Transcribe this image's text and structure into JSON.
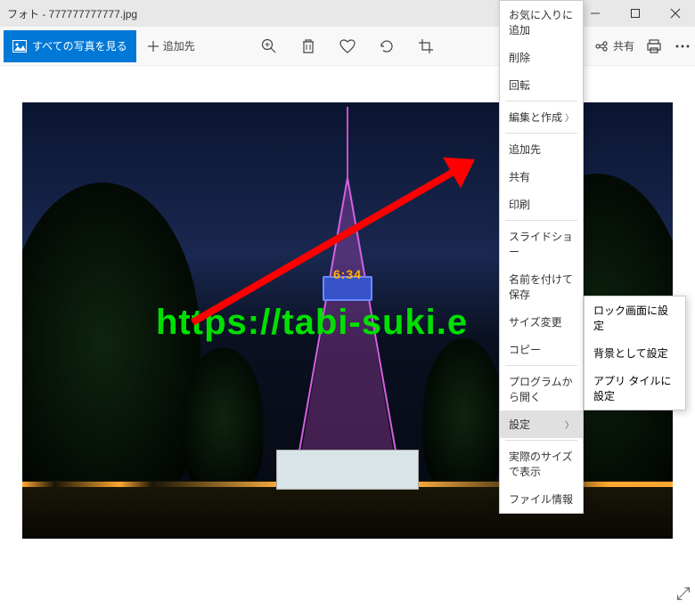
{
  "titlebar": {
    "title": "フォト - 777777777777.jpg"
  },
  "toolbar": {
    "view_all": "すべての写真を見る",
    "add_to": "追加先",
    "share": "共有"
  },
  "image": {
    "tower_sign": "6:34",
    "watermark": "https://tabi-suki.e"
  },
  "context_menu": {
    "items": [
      {
        "label": "お気に入りに追加",
        "arrow": false,
        "hl": false
      },
      {
        "label": "削除",
        "arrow": false,
        "hl": false
      },
      {
        "label": "回転",
        "arrow": false,
        "hl": false
      },
      {
        "sep": true
      },
      {
        "label": "編集と作成",
        "arrow": true,
        "hl": false
      },
      {
        "sep": true
      },
      {
        "label": "追加先",
        "arrow": false,
        "hl": false
      },
      {
        "label": "共有",
        "arrow": false,
        "hl": false
      },
      {
        "label": "印刷",
        "arrow": false,
        "hl": false
      },
      {
        "sep": true
      },
      {
        "label": "スライドショー",
        "arrow": false,
        "hl": false
      },
      {
        "label": "名前を付けて保存",
        "arrow": false,
        "hl": false
      },
      {
        "label": "サイズ変更",
        "arrow": false,
        "hl": false
      },
      {
        "label": "コピー",
        "arrow": false,
        "hl": false
      },
      {
        "sep": true
      },
      {
        "label": "プログラムから開く",
        "arrow": false,
        "hl": false
      },
      {
        "label": "設定",
        "arrow": true,
        "hl": true
      },
      {
        "sep": true
      },
      {
        "label": "実際のサイズで表示",
        "arrow": false,
        "hl": false
      },
      {
        "label": "ファイル情報",
        "arrow": false,
        "hl": false
      }
    ]
  },
  "submenu": {
    "items": [
      {
        "label": "ロック画面に設定"
      },
      {
        "label": "背景として設定"
      },
      {
        "label": "アプリ タイルに設定"
      }
    ]
  }
}
